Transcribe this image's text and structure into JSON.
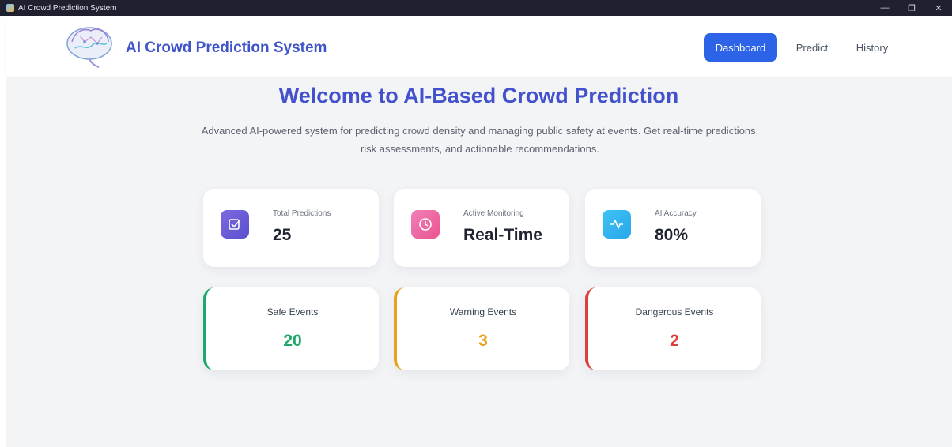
{
  "window": {
    "title": "AI Crowd Prediction System"
  },
  "brand": {
    "title": "AI Crowd Prediction System"
  },
  "nav": [
    {
      "label": "Dashboard",
      "active": true
    },
    {
      "label": "Predict",
      "active": false
    },
    {
      "label": "History",
      "active": false
    }
  ],
  "hero": {
    "title": "Welcome to AI-Based Crowd Prediction",
    "subtitle": "Advanced AI-powered system for predicting crowd density and managing public safety at events. Get real-time predictions, risk assessments, and actionable recommendations."
  },
  "stats": [
    {
      "label": "Total Predictions",
      "value": "25",
      "icon": "checkbox-icon",
      "gradient": [
        "#7c6be0",
        "#5a4fcf"
      ]
    },
    {
      "label": "Active Monitoring",
      "value": "Real-Time",
      "icon": "clock-icon",
      "gradient": [
        "#f27fb8",
        "#e9558f"
      ]
    },
    {
      "label": "AI Accuracy",
      "value": "80%",
      "icon": "activity-icon",
      "gradient": [
        "#3cc3f6",
        "#2aa6e8"
      ]
    }
  ],
  "events": [
    {
      "label": "Safe Events",
      "value": "20",
      "color": "#1fa86a"
    },
    {
      "label": "Warning Events",
      "value": "3",
      "color": "#e7a11b"
    },
    {
      "label": "Dangerous Events",
      "value": "2",
      "color": "#d9423c"
    }
  ]
}
